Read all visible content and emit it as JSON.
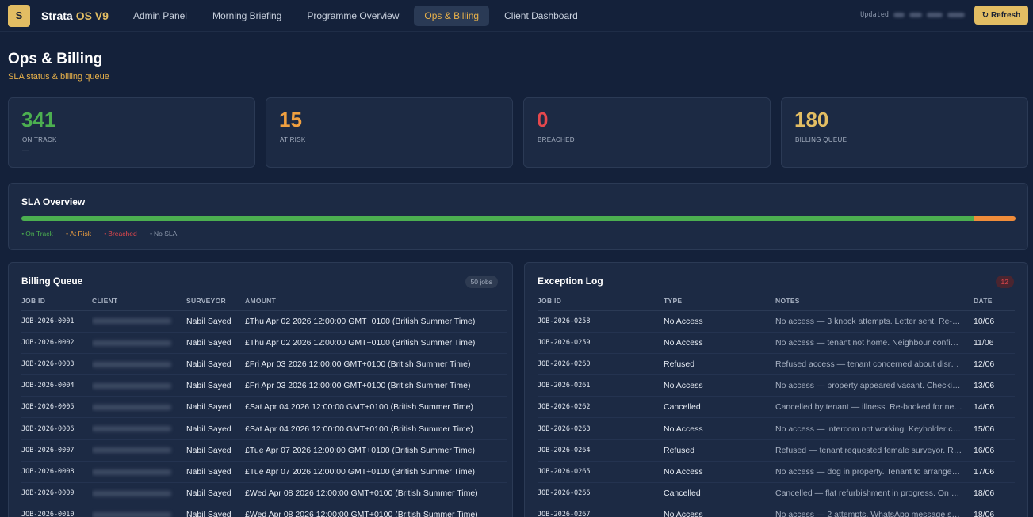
{
  "app": {
    "logo_letter": "S",
    "name": "Strata",
    "version": "OS V9"
  },
  "nav": [
    {
      "label": "Admin Panel",
      "active": false
    },
    {
      "label": "Morning Briefing",
      "active": false
    },
    {
      "label": "Programme Overview",
      "active": false
    },
    {
      "label": "Ops & Billing",
      "active": true
    },
    {
      "label": "Client Dashboard",
      "active": false
    }
  ],
  "header": {
    "updated_label": "Updated",
    "refresh_label": "↻ Refresh"
  },
  "page": {
    "title": "Ops & Billing",
    "subtitle": "SLA status & billing queue"
  },
  "stats": [
    {
      "value": "341",
      "label": "ON TRACK",
      "extra": "—",
      "color": "#4caf50"
    },
    {
      "value": "15",
      "label": "AT RISK",
      "extra": "",
      "color": "#f0a040"
    },
    {
      "value": "0",
      "label": "BREACHED",
      "extra": "",
      "color": "#e5484d"
    },
    {
      "value": "180",
      "label": "BILLING QUEUE",
      "extra": "",
      "color": "#e2bd63"
    }
  ],
  "sla": {
    "title": "SLA Overview",
    "segments": [
      {
        "name": "On Track",
        "value": 341,
        "color": "#4caf50"
      },
      {
        "name": "At Risk",
        "value": 15,
        "color": "#f08c3a"
      },
      {
        "name": "Breached",
        "value": 0,
        "color": "#e5484d"
      },
      {
        "name": "No SLA",
        "value": 0,
        "color": "#8b97ab"
      }
    ],
    "legend": [
      {
        "label": "On Track",
        "color": "#4caf50"
      },
      {
        "label": "At Risk",
        "color": "#f0a040"
      },
      {
        "label": "Breached",
        "color": "#e5484d"
      },
      {
        "label": "No SLA",
        "color": "#8b97ab"
      }
    ]
  },
  "billing": {
    "title": "Billing Queue",
    "badge": "50 jobs",
    "columns": [
      "JOB ID",
      "CLIENT",
      "SURVEYOR",
      "AMOUNT"
    ],
    "rows": [
      {
        "job": "JOB-2026-0001",
        "surveyor": "Nabil Sayed",
        "amount": "£Thu Apr 02 2026 12:00:00 GMT+0100 (British Summer Time)"
      },
      {
        "job": "JOB-2026-0002",
        "surveyor": "Nabil Sayed",
        "amount": "£Thu Apr 02 2026 12:00:00 GMT+0100 (British Summer Time)"
      },
      {
        "job": "JOB-2026-0003",
        "surveyor": "Nabil Sayed",
        "amount": "£Fri Apr 03 2026 12:00:00 GMT+0100 (British Summer Time)"
      },
      {
        "job": "JOB-2026-0004",
        "surveyor": "Nabil Sayed",
        "amount": "£Fri Apr 03 2026 12:00:00 GMT+0100 (British Summer Time)"
      },
      {
        "job": "JOB-2026-0005",
        "surveyor": "Nabil Sayed",
        "amount": "£Sat Apr 04 2026 12:00:00 GMT+0100 (British Summer Time)"
      },
      {
        "job": "JOB-2026-0006",
        "surveyor": "Nabil Sayed",
        "amount": "£Sat Apr 04 2026 12:00:00 GMT+0100 (British Summer Time)"
      },
      {
        "job": "JOB-2026-0007",
        "surveyor": "Nabil Sayed",
        "amount": "£Tue Apr 07 2026 12:00:00 GMT+0100 (British Summer Time)"
      },
      {
        "job": "JOB-2026-0008",
        "surveyor": "Nabil Sayed",
        "amount": "£Tue Apr 07 2026 12:00:00 GMT+0100 (British Summer Time)"
      },
      {
        "job": "JOB-2026-0009",
        "surveyor": "Nabil Sayed",
        "amount": "£Wed Apr 08 2026 12:00:00 GMT+0100 (British Summer Time)"
      },
      {
        "job": "JOB-2026-0010",
        "surveyor": "Nabil Sayed",
        "amount": "£Wed Apr 08 2026 12:00:00 GMT+0100 (British Summer Time)"
      }
    ]
  },
  "exceptions": {
    "title": "Exception Log",
    "badge": "12",
    "columns": [
      "JOB ID",
      "TYPE",
      "NOTES",
      "DATE"
    ],
    "rows": [
      {
        "job": "JOB-2026-0258",
        "type": "No Access",
        "notes": "No access — 3 knock attempts. Letter sent. Re-…",
        "date": "10/06"
      },
      {
        "job": "JOB-2026-0259",
        "type": "No Access",
        "notes": "No access — tenant not home. Neighbour confi…",
        "date": "11/06"
      },
      {
        "job": "JOB-2026-0260",
        "type": "Refused",
        "notes": "Refused access — tenant concerned about disr…",
        "date": "12/06"
      },
      {
        "job": "JOB-2026-0261",
        "type": "No Access",
        "notes": "No access — property appeared vacant. Checki…",
        "date": "13/06"
      },
      {
        "job": "JOB-2026-0262",
        "type": "Cancelled",
        "notes": "Cancelled by tenant — illness. Re-booked for ne…",
        "date": "14/06"
      },
      {
        "job": "JOB-2026-0263",
        "type": "No Access",
        "notes": "No access — intercom not working. Keyholder c…",
        "date": "15/06"
      },
      {
        "job": "JOB-2026-0264",
        "type": "Refused",
        "notes": "Refused — tenant requested female surveyor. R…",
        "date": "16/06"
      },
      {
        "job": "JOB-2026-0265",
        "type": "No Access",
        "notes": "No access — dog in property. Tenant to arrange…",
        "date": "17/06"
      },
      {
        "job": "JOB-2026-0266",
        "type": "Cancelled",
        "notes": "Cancelled — flat refurbishment in progress. On …",
        "date": "18/06"
      },
      {
        "job": "JOB-2026-0267",
        "type": "No Access",
        "notes": "No access — 2 attempts. WhatsApp message s…",
        "date": "18/06"
      }
    ]
  }
}
